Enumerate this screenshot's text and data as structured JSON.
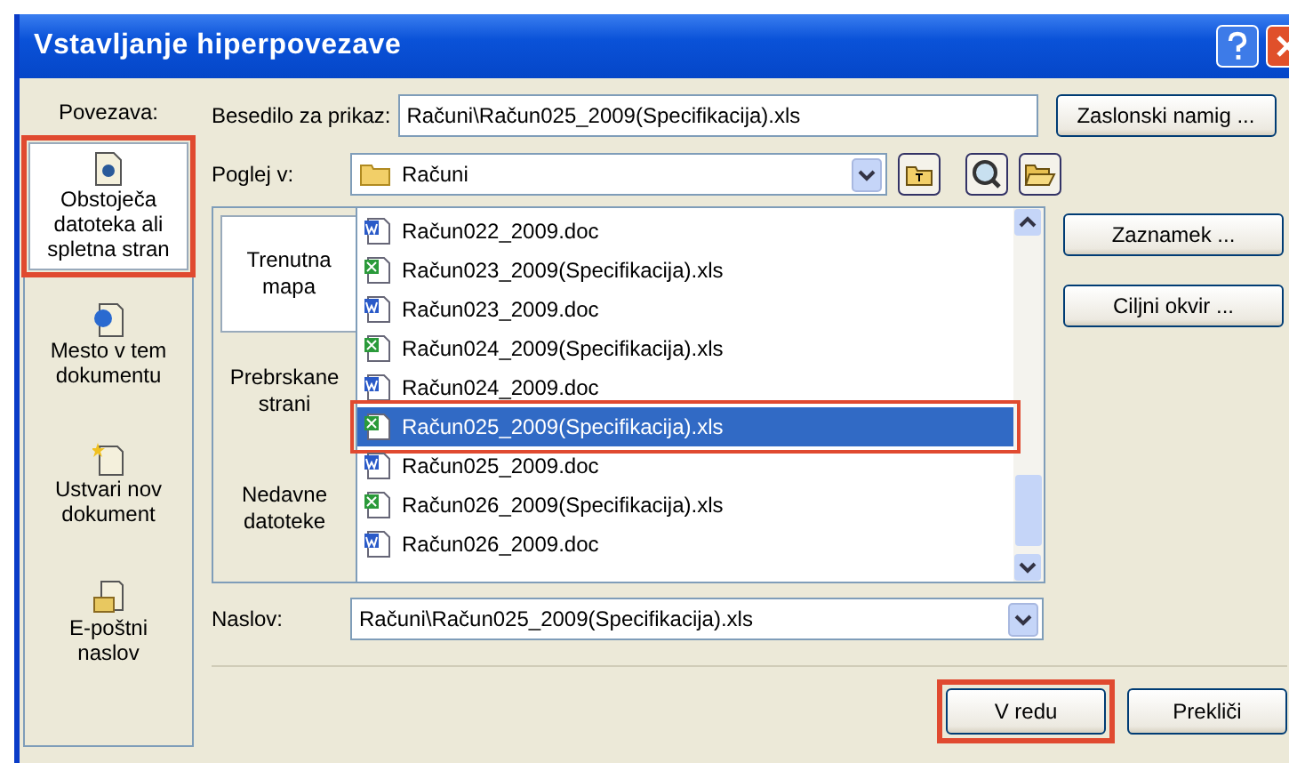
{
  "window": {
    "title": "Vstavljanje hiperpovezave"
  },
  "link_to": {
    "label": "Povezava:",
    "items": [
      {
        "kind": "file",
        "label": "Obstoječa datoteka ali spletna stran",
        "selected": true,
        "highlighted": true
      },
      {
        "kind": "place",
        "label": "Mesto v tem dokumentu",
        "selected": false,
        "highlighted": false
      },
      {
        "kind": "new",
        "label": "Ustvari nov dokument",
        "selected": false,
        "highlighted": false
      },
      {
        "kind": "email",
        "label": "E-poštni naslov",
        "selected": false,
        "highlighted": false
      }
    ]
  },
  "display_text": {
    "label": "Besedilo za prikaz:",
    "value": "Računi\\Račun025_2009(Specifikacija).xls"
  },
  "screen_tip_button": "Zaslonski namig ...",
  "look_in": {
    "label": "Poglej v:",
    "value": "Računi"
  },
  "browse_tabs": [
    {
      "label": "Trenutna mapa",
      "selected": true
    },
    {
      "label": "Prebrskane strani",
      "selected": false
    },
    {
      "label": "Nedavne datoteke",
      "selected": false
    }
  ],
  "files": [
    {
      "kind": "word",
      "name": "Račun022_2009.doc",
      "selected": false,
      "highlighted": false
    },
    {
      "kind": "excel",
      "name": "Račun023_2009(Specifikacija).xls",
      "selected": false,
      "highlighted": false
    },
    {
      "kind": "word",
      "name": "Račun023_2009.doc",
      "selected": false,
      "highlighted": false
    },
    {
      "kind": "excel",
      "name": "Račun024_2009(Specifikacija).xls",
      "selected": false,
      "highlighted": false
    },
    {
      "kind": "word",
      "name": "Račun024_2009.doc",
      "selected": false,
      "highlighted": false
    },
    {
      "kind": "excel",
      "name": "Račun025_2009(Specifikacija).xls",
      "selected": true,
      "highlighted": true
    },
    {
      "kind": "word",
      "name": "Račun025_2009.doc",
      "selected": false,
      "highlighted": false
    },
    {
      "kind": "excel",
      "name": "Račun026_2009(Specifikacija).xls",
      "selected": false,
      "highlighted": false
    },
    {
      "kind": "word",
      "name": "Račun026_2009.doc",
      "selected": false,
      "highlighted": false
    }
  ],
  "side_buttons": [
    "Zaznamek ...",
    "Ciljni okvir ..."
  ],
  "address": {
    "label": "Naslov:",
    "value": "Računi\\Račun025_2009(Specifikacija).xls"
  },
  "buttons": [
    {
      "label": "V redu",
      "highlighted": true
    },
    {
      "label": "Prekliči",
      "highlighted": false
    }
  ]
}
